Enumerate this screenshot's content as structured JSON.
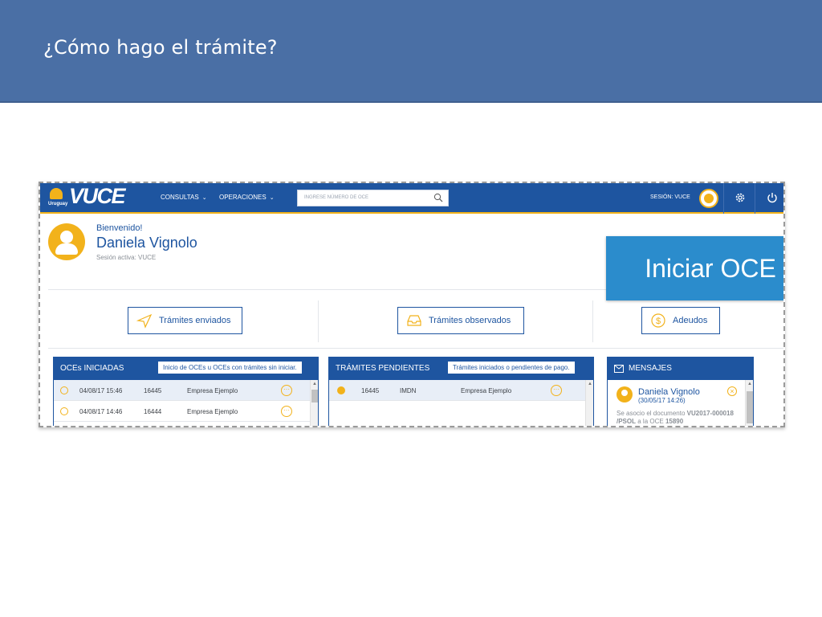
{
  "slide": {
    "title": "¿Cómo hago el trámite?"
  },
  "app": {
    "logo": {
      "sub": "Uruguay",
      "text": "VUCE"
    },
    "nav": [
      {
        "label": "CONSULTAS"
      },
      {
        "label": "OPERACIONES"
      }
    ],
    "search": {
      "placeholder": "INGRESE NÚMERO DE OCE"
    },
    "session": "SESIÓN: VUCE",
    "icons": {
      "search": "search-icon",
      "gear": "gear-icon",
      "power": "power-icon",
      "chevron": "chevron-down-icon"
    }
  },
  "welcome": {
    "greeting": "Bienvenido!",
    "name": "Daniela Vignolo",
    "session_active": "Sesión activa: VUCE"
  },
  "actions": [
    {
      "label": "Trámites enviados",
      "icon": "send-icon"
    },
    {
      "label": "Trámites observados",
      "icon": "inbox-icon"
    },
    {
      "label": "Adeudos",
      "icon": "dollar-icon"
    }
  ],
  "callout": {
    "label": "Iniciar OCE"
  },
  "panels": {
    "oces": {
      "title": "OCEs INICIADAS",
      "tip": "Inicio de OCEs u OCEs con trámites sin iniciar.",
      "rows": [
        {
          "date": "04/08/17 15:46",
          "id": "16445",
          "company": "Empresa Ejemplo"
        },
        {
          "date": "04/08/17 14:46",
          "id": "16444",
          "company": "Empresa Ejemplo"
        }
      ]
    },
    "pendientes": {
      "title": "TRÁMITES PENDIENTES",
      "tip": "Trámites iniciados o pendientes de pago.",
      "rows": [
        {
          "id": "16445",
          "type": "IMDN",
          "company": "Empresa Ejemplo"
        }
      ]
    },
    "mensajes": {
      "title": "MENSAJES",
      "item": {
        "name": "Daniela Vignolo",
        "date": "(30/05/17 14:26)",
        "body_prefix": "Se asocio el documento",
        "body_doc": "VU2017-000018 /PSOL",
        "body_mid": "a la OCE",
        "body_oce": "15890"
      }
    }
  },
  "colors": {
    "header": "#4a6fa5",
    "brand": "#1e55a0",
    "accent": "#f2b21b",
    "callout": "#2b8ccc"
  }
}
